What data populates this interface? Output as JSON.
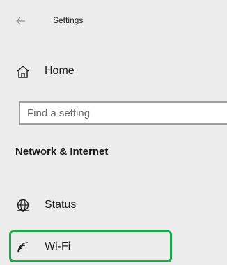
{
  "titlebar": {
    "back_icon": "back-arrow-icon",
    "title": "Settings"
  },
  "nav": {
    "home": {
      "icon": "home-icon",
      "label": "Home"
    }
  },
  "search": {
    "placeholder": "Find a setting",
    "value": ""
  },
  "section": {
    "heading": "Network & Internet",
    "items": [
      {
        "icon": "globe-status-icon",
        "label": "Status"
      },
      {
        "icon": "wifi-icon",
        "label": "Wi-Fi",
        "highlighted": true
      }
    ]
  },
  "colors": {
    "pane_background": "#ececec",
    "highlight_border": "#1fa64a",
    "text": "#1a1a1a"
  }
}
